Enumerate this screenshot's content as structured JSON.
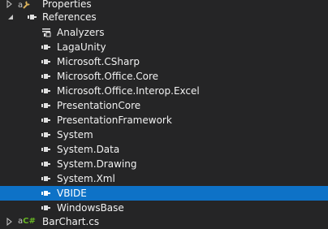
{
  "tree": {
    "properties": {
      "label": "Properties"
    },
    "references": {
      "label": "References",
      "items": [
        {
          "label": "Analyzers",
          "icon": "analyzer-icon"
        },
        {
          "label": "LagaUnity",
          "icon": "reference-icon"
        },
        {
          "label": "Microsoft.CSharp",
          "icon": "reference-icon"
        },
        {
          "label": "Microsoft.Office.Core",
          "icon": "reference-icon"
        },
        {
          "label": "Microsoft.Office.Interop.Excel",
          "icon": "reference-icon"
        },
        {
          "label": "PresentationCore",
          "icon": "reference-icon"
        },
        {
          "label": "PresentationFramework",
          "icon": "reference-icon"
        },
        {
          "label": "System",
          "icon": "reference-icon"
        },
        {
          "label": "System.Data",
          "icon": "reference-icon"
        },
        {
          "label": "System.Drawing",
          "icon": "reference-icon"
        },
        {
          "label": "System.Xml",
          "icon": "reference-icon"
        },
        {
          "label": "VBIDE",
          "icon": "reference-icon",
          "selected": true
        },
        {
          "label": "WindowsBase",
          "icon": "reference-icon"
        }
      ]
    },
    "barchart": {
      "label": "BarChart.cs",
      "icon_text": "C#"
    }
  },
  "colors": {
    "background": "#252526",
    "selection": "#0e72c7",
    "text": "#f1f1f1",
    "csharp": "#68b723",
    "wrench": "#d8b05a"
  }
}
